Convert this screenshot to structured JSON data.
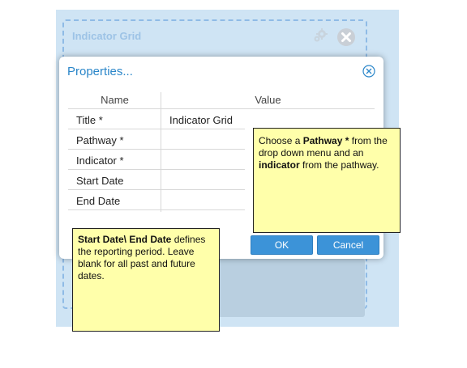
{
  "widget": {
    "title": "Indicator Grid",
    "settings_icon": "gear-icon",
    "close_icon": "close-circle-icon"
  },
  "dialog": {
    "title": "Properties...",
    "close_icon": "close-circle-icon",
    "columns": {
      "name": "Name",
      "value": "Value"
    },
    "rows": [
      {
        "name": "Title *",
        "value": "Indicator Grid"
      },
      {
        "name": "Pathway *",
        "value": ""
      },
      {
        "name": "Indicator *",
        "value": ""
      },
      {
        "name": "Start Date",
        "value": ""
      },
      {
        "name": "End Date",
        "value": ""
      }
    ],
    "ok_label": "OK",
    "cancel_label": "Cancel"
  },
  "notes": {
    "pathway": {
      "p1": "Choose a ",
      "b1": "Pathway *",
      "p2": " from the drop down menu and an ",
      "b2": "indicator",
      "p3": " from the pathway."
    },
    "dates": {
      "b1": "Start Date\\ End Date",
      "p1": " defines the reporting period. Leave blank for all past and future dates."
    }
  },
  "colors": {
    "accent": "#2a86c9",
    "note_bg": "#ffffaa",
    "backdrop": "#cfe4f4"
  }
}
